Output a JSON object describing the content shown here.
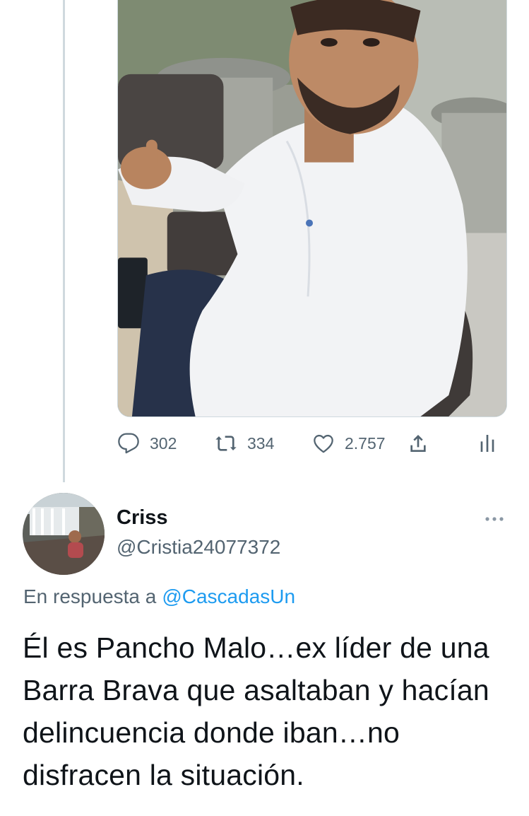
{
  "original_tweet": {
    "photo": {
      "description_icon": "photo-icon"
    },
    "actions": {
      "reply": {
        "icon": "reply-icon",
        "count": "302"
      },
      "retweet": {
        "icon": "retweet-icon",
        "count": "334"
      },
      "like": {
        "icon": "heart-icon",
        "count": "2.757"
      },
      "share": {
        "icon": "share-icon"
      },
      "analytics": {
        "icon": "analytics-icon"
      }
    }
  },
  "reply": {
    "display_name": "Criss",
    "handle": "@Cristia24077372",
    "reply_context": {
      "prefix": "En respuesta a",
      "mention": "@CascadasUn"
    },
    "text": "Él es Pancho Malo…ex líder de una Barra Brava que asaltaban y hacían delincuencia donde iban…no disfracen la situación."
  },
  "colors": {
    "text_primary": "#0f1419",
    "text_secondary": "#536471",
    "accent": "#1d9bf0",
    "divider": "#cfd9de"
  }
}
